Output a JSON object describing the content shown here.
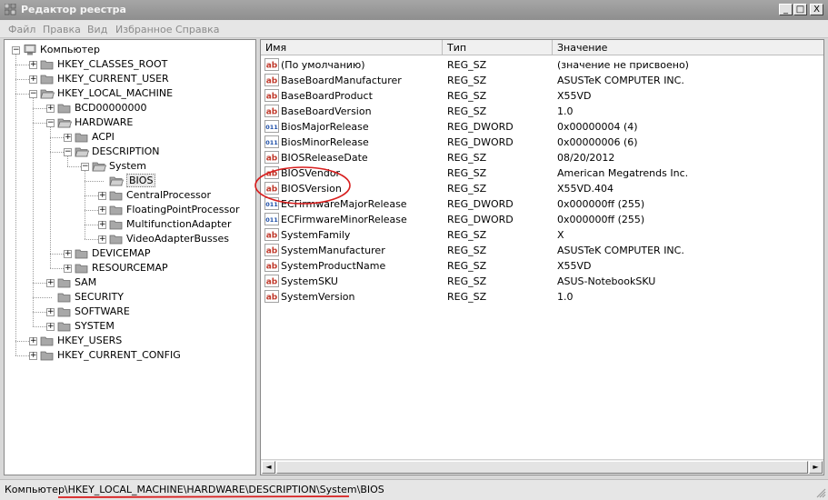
{
  "window": {
    "title": "Редактор реестра",
    "controls": {
      "minimize": "_",
      "maximize": "□",
      "close": "X"
    }
  },
  "menu": [
    "Файл",
    "Правка",
    "Вид",
    "Избранное",
    "Справка"
  ],
  "tree": {
    "nodes": [
      {
        "label": "Компьютер",
        "depth": 0,
        "expander": "-"
      },
      {
        "label": "HKEY_CLASSES_ROOT",
        "depth": 1,
        "expander": "+"
      },
      {
        "label": "HKEY_CURRENT_USER",
        "depth": 1,
        "expander": "+"
      },
      {
        "label": "HKEY_LOCAL_MACHINE",
        "depth": 1,
        "expander": "-"
      },
      {
        "label": "BCD00000000",
        "depth": 2,
        "expander": "+"
      },
      {
        "label": "HARDWARE",
        "depth": 2,
        "expander": "-"
      },
      {
        "label": "ACPI",
        "depth": 3,
        "expander": "+"
      },
      {
        "label": "DESCRIPTION",
        "depth": 3,
        "expander": "-"
      },
      {
        "label": "System",
        "depth": 4,
        "expander": "-"
      },
      {
        "label": "BIOS",
        "depth": 5,
        "expander": "",
        "selected": true
      },
      {
        "label": "CentralProcessor",
        "depth": 5,
        "expander": "+"
      },
      {
        "label": "FloatingPointProcessor",
        "depth": 5,
        "expander": "+"
      },
      {
        "label": "MultifunctionAdapter",
        "depth": 5,
        "expander": "+"
      },
      {
        "label": "VideoAdapterBusses",
        "depth": 5,
        "expander": "+"
      },
      {
        "label": "DEVICEMAP",
        "depth": 3,
        "expander": "+"
      },
      {
        "label": "RESOURCEMAP",
        "depth": 3,
        "expander": "+"
      },
      {
        "label": "SAM",
        "depth": 2,
        "expander": "+"
      },
      {
        "label": "SECURITY",
        "depth": 2,
        "expander": ""
      },
      {
        "label": "SOFTWARE",
        "depth": 2,
        "expander": "+"
      },
      {
        "label": "SYSTEM",
        "depth": 2,
        "expander": "+"
      },
      {
        "label": "HKEY_USERS",
        "depth": 1,
        "expander": "+"
      },
      {
        "label": "HKEY_CURRENT_CONFIG",
        "depth": 1,
        "expander": "+"
      }
    ]
  },
  "list": {
    "columns": [
      "Имя",
      "Тип",
      "Значение"
    ],
    "rows": [
      {
        "icon": "string-value-icon",
        "name": "(По умолчанию)",
        "type": "REG_SZ",
        "value": "(значение не присвоено)"
      },
      {
        "icon": "string-value-icon",
        "name": "BaseBoardManufacturer",
        "type": "REG_SZ",
        "value": "ASUSTeK COMPUTER INC."
      },
      {
        "icon": "string-value-icon",
        "name": "BaseBoardProduct",
        "type": "REG_SZ",
        "value": "X55VD"
      },
      {
        "icon": "string-value-icon",
        "name": "BaseBoardVersion",
        "type": "REG_SZ",
        "value": "1.0"
      },
      {
        "icon": "binary-value-icon",
        "name": "BiosMajorRelease",
        "type": "REG_DWORD",
        "value": "0x00000004 (4)"
      },
      {
        "icon": "binary-value-icon",
        "name": "BiosMinorRelease",
        "type": "REG_DWORD",
        "value": "0x00000006 (6)"
      },
      {
        "icon": "string-value-icon",
        "name": "BIOSReleaseDate",
        "type": "REG_SZ",
        "value": "08/20/2012"
      },
      {
        "icon": "string-value-icon",
        "name": "BIOSVendor",
        "type": "REG_SZ",
        "value": "American Megatrends Inc."
      },
      {
        "icon": "string-value-icon",
        "name": "BIOSVersion",
        "type": "REG_SZ",
        "value": "X55VD.404"
      },
      {
        "icon": "binary-value-icon",
        "name": "ECFirmwareMajorRelease",
        "type": "REG_DWORD",
        "value": "0x000000ff (255)"
      },
      {
        "icon": "binary-value-icon",
        "name": "ECFirmwareMinorRelease",
        "type": "REG_DWORD",
        "value": "0x000000ff (255)"
      },
      {
        "icon": "string-value-icon",
        "name": "SystemFamily",
        "type": "REG_SZ",
        "value": "X"
      },
      {
        "icon": "string-value-icon",
        "name": "SystemManufacturer",
        "type": "REG_SZ",
        "value": "ASUSTeK COMPUTER INC."
      },
      {
        "icon": "string-value-icon",
        "name": "SystemProductName",
        "type": "REG_SZ",
        "value": "X55VD"
      },
      {
        "icon": "string-value-icon",
        "name": "SystemSKU",
        "type": "REG_SZ",
        "value": "ASUS-NotebookSKU"
      },
      {
        "icon": "string-value-icon",
        "name": "SystemVersion",
        "type": "REG_SZ",
        "value": "1.0"
      }
    ],
    "string_icon_text": "ab",
    "binary_icon_text": "011"
  },
  "status": {
    "path_prefix": "Компьютер\\",
    "path_rest": "HKEY_LOCAL_MACHINE\\HARDWARE\\DESCRIPTION\\System\\BIOS"
  },
  "colors": {
    "annotation_red": "#d81e1e",
    "string_icon_red": "#c0392b",
    "binary_icon_blue": "#1f4fa8",
    "folder_fill": "#a8a8a8"
  },
  "scrollbar": {
    "left": "◄",
    "right": "►"
  }
}
